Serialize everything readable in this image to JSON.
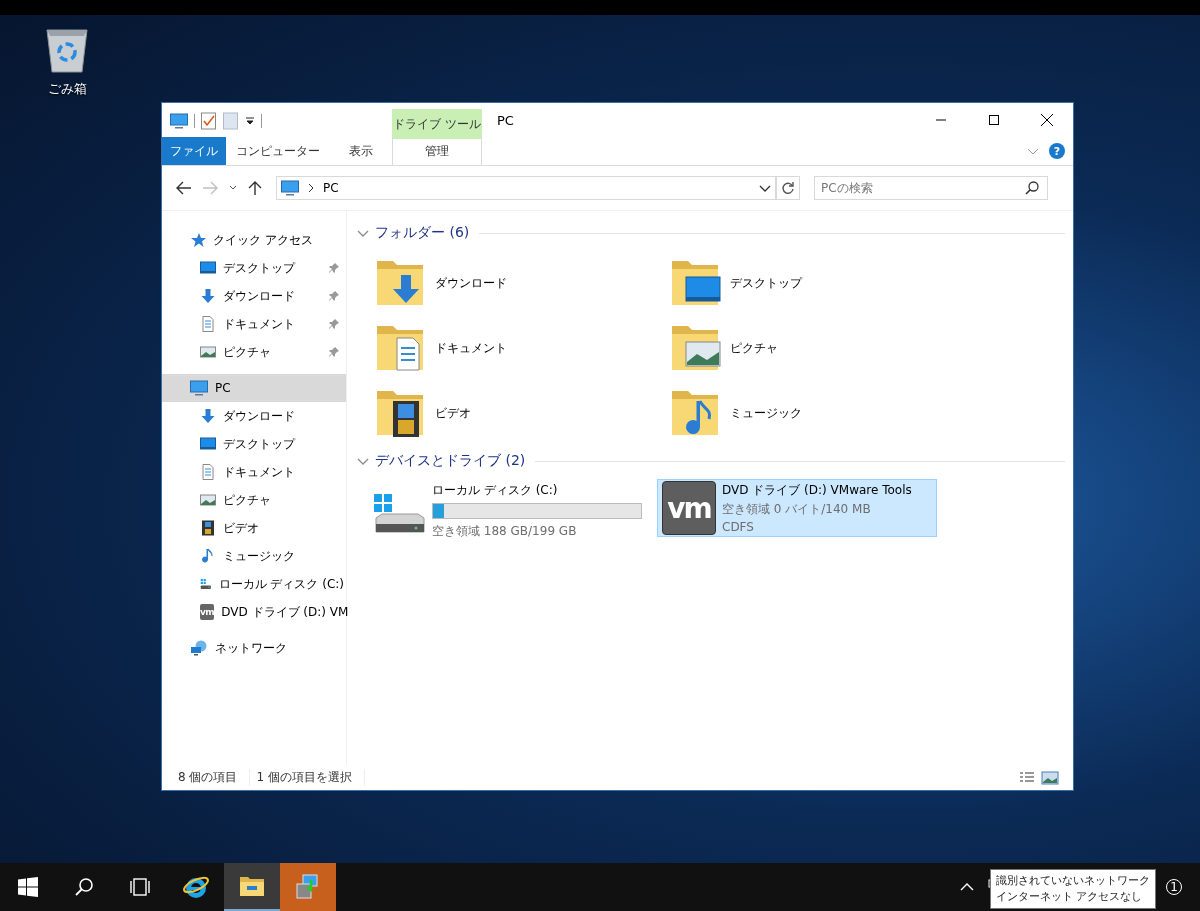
{
  "desktop_icons": [
    {
      "label": "ごみ箱",
      "kind": "recycle-bin"
    }
  ],
  "window": {
    "title": "PC",
    "context_group": "ドライブ ツール",
    "help": "?",
    "ribbon_tabs": [
      {
        "label": "ファイル",
        "kind": "file",
        "selected": false
      },
      {
        "label": "コンピューター",
        "kind": "tab",
        "selected": false
      },
      {
        "label": "表示",
        "kind": "tab",
        "selected": false
      },
      {
        "label": "管理",
        "kind": "context",
        "selected": false
      }
    ],
    "address": {
      "path": "PC"
    },
    "search": {
      "placeholder": "PCの検索"
    },
    "nav": [
      {
        "label": "クイック アクセス",
        "kind": "star",
        "selected": false,
        "children": [
          {
            "label": "デスクトップ",
            "kind": "desktop",
            "pinned": true,
            "selected": false
          },
          {
            "label": "ダウンロード",
            "kind": "downloads",
            "pinned": true,
            "selected": false
          },
          {
            "label": "ドキュメント",
            "kind": "documents",
            "pinned": true,
            "selected": false
          },
          {
            "label": "ピクチャ",
            "kind": "pictures",
            "pinned": true,
            "selected": false
          }
        ]
      },
      {
        "label": "PC",
        "kind": "pc",
        "selected": true,
        "children": [
          {
            "label": "ダウンロード",
            "kind": "downloads",
            "pinned": false,
            "selected": false
          },
          {
            "label": "デスクトップ",
            "kind": "desktop",
            "pinned": false,
            "selected": false
          },
          {
            "label": "ドキュメント",
            "kind": "documents",
            "pinned": false,
            "selected": false
          },
          {
            "label": "ピクチャ",
            "kind": "pictures",
            "pinned": false,
            "selected": false
          },
          {
            "label": "ビデオ",
            "kind": "videos",
            "pinned": false,
            "selected": false
          },
          {
            "label": "ミュージック",
            "kind": "music",
            "pinned": false,
            "selected": false
          },
          {
            "label": "ローカル ディスク (C:)",
            "kind": "hdd",
            "pinned": false,
            "selected": false
          },
          {
            "label": "DVD ドライブ (D:) VM",
            "kind": "dvd-vm",
            "badge": "vm",
            "pinned": false,
            "selected": false
          }
        ]
      },
      {
        "label": "ネットワーク",
        "kind": "network",
        "selected": false
      }
    ],
    "folders": {
      "title": "フォルダー (6)",
      "expanded": true,
      "items": [
        {
          "label": "ダウンロード",
          "kind": "downloads"
        },
        {
          "label": "デスクトップ",
          "kind": "desktop"
        },
        {
          "label": "ドキュメント",
          "kind": "documents"
        },
        {
          "label": "ピクチャ",
          "kind": "pictures"
        },
        {
          "label": "ビデオ",
          "kind": "videos"
        },
        {
          "label": "ミュージック",
          "kind": "music"
        }
      ]
    },
    "devices": {
      "title": "デバイスとドライブ (2)",
      "expanded": true,
      "items": [
        {
          "label": "ローカル ディスク (C:)",
          "kind": "hdd",
          "level": 0.055,
          "detail": "空き領域 188 GB/199 GB",
          "selected": false
        },
        {
          "label": "DVD ドライブ (D:) VMware Tools",
          "kind": "dvd-vm",
          "badge": "vm",
          "detail": "空き領域 0 バイト/140 MB",
          "filesystem": "CDFS",
          "selected": true
        }
      ]
    },
    "status_bar": {
      "item_count": "8 個の項目",
      "selection": "1 個の項目を選択"
    }
  },
  "taskbar": {
    "apps": [
      {
        "kind": "start",
        "active": false,
        "flashing": false
      },
      {
        "kind": "search",
        "active": false,
        "flashing": false
      },
      {
        "kind": "task-view",
        "active": false,
        "flashing": false
      },
      {
        "kind": "browser",
        "active": false,
        "flashing": false
      },
      {
        "kind": "explorer",
        "active": true,
        "flashing": false
      },
      {
        "kind": "installer",
        "active": false,
        "flashing": true
      }
    ],
    "tooltip": [
      "識別されていないネットワーク",
      "インターネット アクセスなし"
    ],
    "notification_count": "1"
  }
}
